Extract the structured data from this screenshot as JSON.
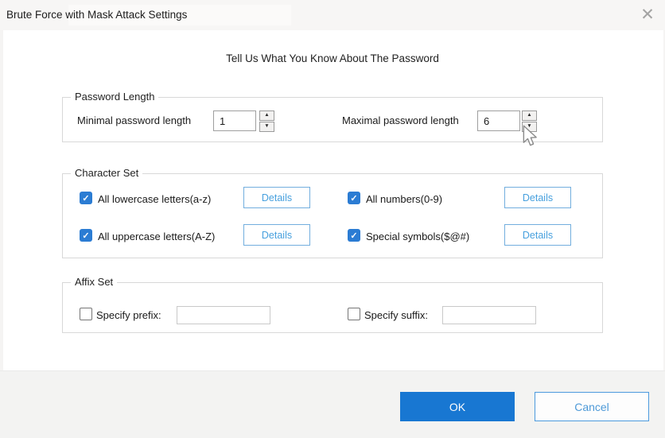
{
  "window": {
    "title": "Brute Force with Mask Attack Settings"
  },
  "icons": {
    "close": "✕",
    "check": "✓",
    "spin_up": "▲",
    "spin_down": "▼"
  },
  "heading": "Tell Us What You Know About The Password",
  "password_length": {
    "legend": "Password Length",
    "min_label": "Minimal password length",
    "min_value": "1",
    "max_label": "Maximal password length",
    "max_value": "6"
  },
  "character_set": {
    "legend": "Character Set",
    "details_label": "Details",
    "options": [
      {
        "label": "All lowercase letters(a-z)",
        "checked": true
      },
      {
        "label": "All numbers(0-9)",
        "checked": true
      },
      {
        "label": "All uppercase letters(A-Z)",
        "checked": true
      },
      {
        "label": "Special symbols($@#)",
        "checked": true
      }
    ]
  },
  "affix_set": {
    "legend": "Affix Set",
    "prefix": {
      "label": "Specify prefix:",
      "value": "",
      "checked": false
    },
    "suffix": {
      "label": "Specify suffix:",
      "value": "",
      "checked": false
    }
  },
  "footer": {
    "ok_label": "OK",
    "cancel_label": "Cancel"
  },
  "colors": {
    "accent_blue": "#1877d2",
    "details_blue": "#47a0de",
    "checkbox_blue": "#2b7cd3",
    "titlebar_bg": "#f7f6f5",
    "footer_bg": "#f3f3f2"
  }
}
